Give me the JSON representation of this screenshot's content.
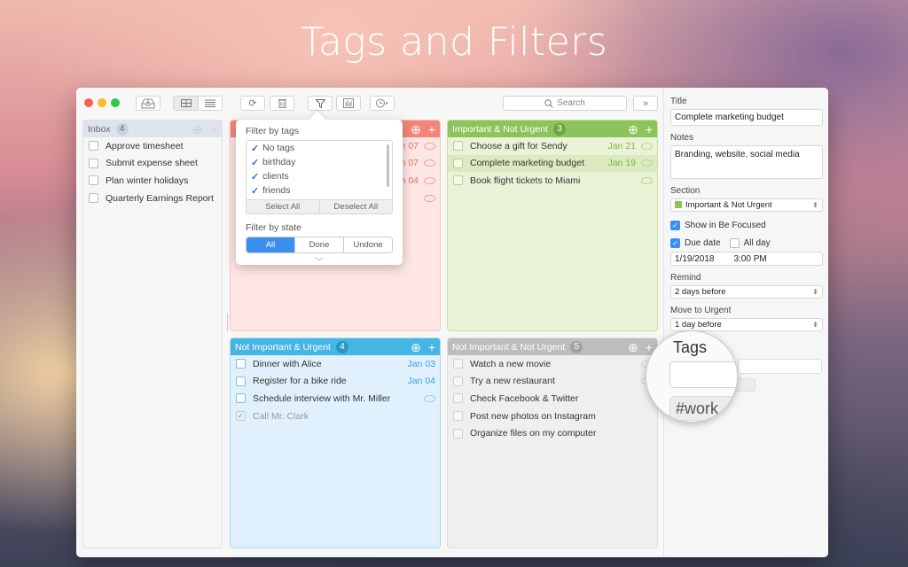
{
  "hero_title": "Tags and Filters",
  "toolbar": {
    "buttons": [
      {
        "name": "inbox",
        "icon": "inbox-tray-icon"
      },
      {
        "name": "grid-view",
        "icon": "grid-icon",
        "active": true
      },
      {
        "name": "list-view",
        "icon": "list-icon"
      },
      {
        "name": "sync",
        "icon": "refresh-icon"
      },
      {
        "name": "trash",
        "icon": "trash-icon"
      },
      {
        "name": "filter",
        "icon": "filter-funnel-icon"
      },
      {
        "name": "statistics",
        "icon": "bar-chart-icon"
      },
      {
        "name": "timer",
        "icon": "clock-menu-icon"
      }
    ],
    "search_placeholder": "Search",
    "more_label": "»"
  },
  "inbox": {
    "title": "Inbox",
    "count": "4",
    "tasks": [
      {
        "title": "Approve timesheet"
      },
      {
        "title": "Submit expense sheet"
      },
      {
        "title": "Plan winter holidays"
      },
      {
        "title": "Quarterly Earnings Report"
      }
    ]
  },
  "quadrants": {
    "important_urgent": {
      "color": "#f5857a",
      "partial_dates": [
        "n 07",
        "n 07",
        "n 04",
        ""
      ]
    },
    "important_not_urgent": {
      "title": "Important & Not Urgent",
      "count": "3",
      "color": "#8cc45c",
      "tasks": [
        {
          "title": "Choose a gift for Sendy",
          "due": "Jan 21"
        },
        {
          "title": "Complete marketing budget",
          "due": "Jan 19",
          "selected": true
        },
        {
          "title": "Book flight tickets to Miami",
          "due": ""
        }
      ]
    },
    "not_important_urgent": {
      "title": "Not Important & Urgent",
      "count": "4",
      "color": "#45b6e4",
      "tasks": [
        {
          "title": "Dinner with Alice",
          "due": "Jan 03"
        },
        {
          "title": "Register for a bike ride",
          "due": "Jan 04"
        },
        {
          "title": "Schedule interview with Mr. Miller",
          "due": ""
        },
        {
          "title": "Call Mr. Clark",
          "due": "",
          "done": true
        }
      ]
    },
    "not_important_not_urgent": {
      "title": "Not Important & Not Urgent",
      "count": "5",
      "color": "#bdbdbd",
      "tasks": [
        {
          "title": "Watch a new movie"
        },
        {
          "title": "Try a new restaurant"
        },
        {
          "title": "Check Facebook & Twitter"
        },
        {
          "title": "Post new photos on Instagram"
        },
        {
          "title": "Organize files on my computer"
        }
      ]
    }
  },
  "filter_popover": {
    "tags_label": "Filter by tags",
    "tags": [
      {
        "label": "No tags",
        "checked": true
      },
      {
        "label": "birthday",
        "checked": true
      },
      {
        "label": "clients",
        "checked": true
      },
      {
        "label": "friends",
        "checked": true
      }
    ],
    "select_all": "Select All",
    "deselect_all": "Deselect All",
    "state_label": "Filter by state",
    "states": [
      {
        "label": "All",
        "active": true
      },
      {
        "label": "Done",
        "active": false
      },
      {
        "label": "Undone",
        "active": false
      }
    ]
  },
  "detail": {
    "title_label": "Title",
    "title_value": "Complete marketing budget",
    "notes_label": "Notes",
    "notes_value": "Branding, website, social media",
    "section_label": "Section",
    "section_value": "Important & Not Urgent",
    "section_color": "#8cc45c",
    "show_in_focused_label": "Show in Be Focused",
    "show_in_focused": true,
    "due_date_label": "Due date",
    "due_date_checked": true,
    "all_day_label": "All day",
    "all_day_checked": false,
    "date_value": "1/19/2018",
    "time_value": "3:00 PM",
    "remind_label": "Remind",
    "remind_value": "2 days before",
    "move_label": "Move to Urgent",
    "move_value": "1 day before",
    "tags_label": "Tags",
    "tag_chip": "#work"
  }
}
